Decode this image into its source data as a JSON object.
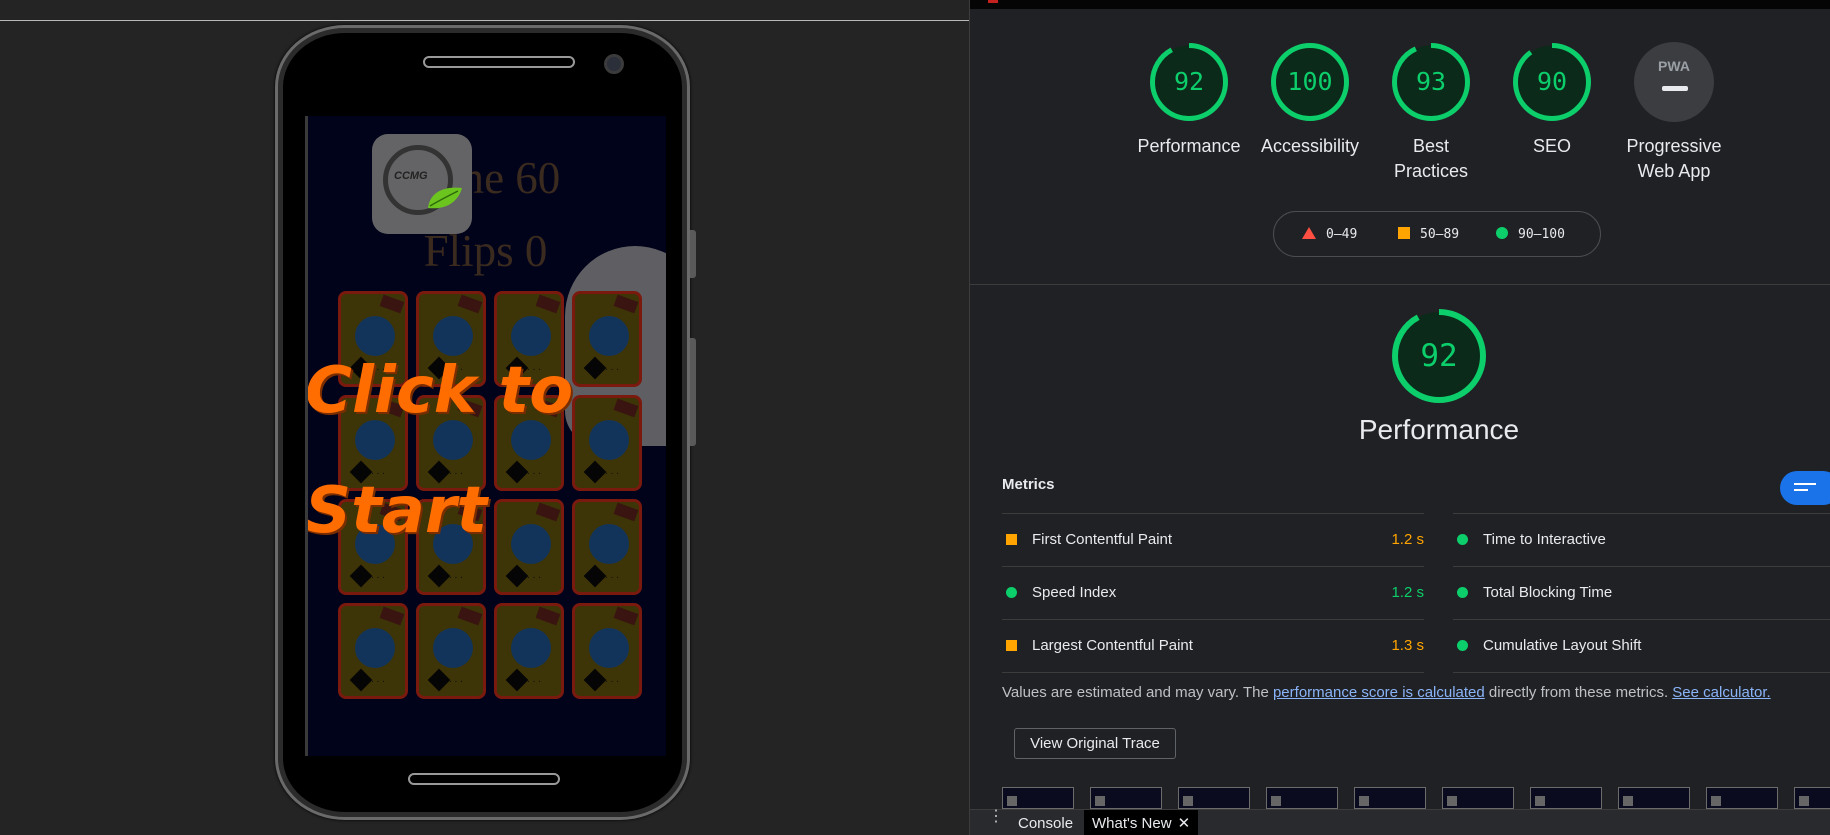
{
  "device": {
    "game": {
      "time_text": "Time 60",
      "flips_text": "Flips 0",
      "logo_text": "CCMG",
      "overlay_line1": "Click to",
      "overlay_line2": "Start",
      "card_count": 16
    }
  },
  "lighthouse": {
    "categories": [
      {
        "label": "Performance",
        "score": "92",
        "value": 92
      },
      {
        "label": "Accessibility",
        "score": "100",
        "value": 100
      },
      {
        "label": "Best Practices",
        "score": "93",
        "value": 93
      },
      {
        "label": "SEO",
        "score": "90",
        "value": 90
      },
      {
        "label": "Progressive Web App",
        "badge": "PWA"
      }
    ],
    "legend": {
      "fail": "0–49",
      "average": "50–89",
      "pass": "90–100"
    },
    "performance": {
      "score": "92",
      "value": 92,
      "title": "Performance"
    },
    "metrics_label": "Metrics",
    "metrics_left": [
      {
        "name": "First Contentful Paint",
        "value": "1.2 s",
        "status": "average"
      },
      {
        "name": "Speed Index",
        "value": "1.2 s",
        "status": "pass"
      },
      {
        "name": "Largest Contentful Paint",
        "value": "1.3 s",
        "status": "average"
      }
    ],
    "metrics_right": [
      {
        "name": "Time to Interactive",
        "status": "pass"
      },
      {
        "name": "Total Blocking Time",
        "status": "pass"
      },
      {
        "name": "Cumulative Layout Shift",
        "status": "pass"
      }
    ],
    "note": {
      "prefix": "Values are estimated and may vary. The ",
      "link1": "performance score is calculated",
      "middle": " directly from these metrics. ",
      "link2": "See calculator."
    },
    "trace_button": "View Original Trace",
    "colors": {
      "pass": "#0cce6b",
      "average": "#ffa400",
      "fail": "#ff4e42"
    }
  },
  "drawer": {
    "tabs": [
      "Console",
      "What's New"
    ],
    "close_icon": "close-icon"
  }
}
